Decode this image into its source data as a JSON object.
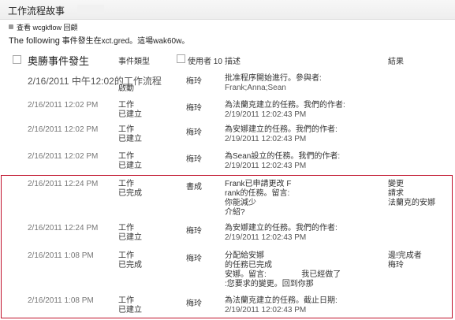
{
  "header": {
    "title": "工作流程故事"
  },
  "view_link": "查看 wcgkflow 回顧",
  "notice": {
    "lead": "The following",
    "rest": "事件發生在xct.gred。這場wak60w。"
  },
  "columns": {
    "date": "奧勝事件發生",
    "event_type": "事件類型",
    "user": "使用者 10",
    "description": "描述",
    "outcome": "結果"
  },
  "rows": [
    {
      "date": "2/16/2011 中午12:02的工作流程",
      "event": [
        "",
        "啟動"
      ],
      "user": "梅玲",
      "desc": [
        "批准程序開始進行。參與者:",
        "Frank;Anna;Sean"
      ],
      "result": []
    },
    {
      "date": "2/16/2011 12:02 PM",
      "event": [
        "工作",
        "已建立"
      ],
      "user": "梅玲",
      "desc": [
        "為法蘭克建立的任務。我們的作者:",
        "2/19/2011 12:02:43 PM"
      ],
      "result": []
    },
    {
      "date": "2/16/2011 12:02 PM",
      "event": [
        "工作",
        "已建立"
      ],
      "user": "梅玲",
      "desc": [
        "為安娜建立的任務。我們的作者:",
        "2/19/2011 12:02:43 PM"
      ],
      "result": []
    },
    {
      "date": "2/16/2011 12:02 PM",
      "event": [
        "工作",
        "已建立"
      ],
      "user": "梅玲",
      "desc": [
        "為Sean設立的任務。我們的作者:",
        "2/19/2011 12:02:43 PM"
      ],
      "result": []
    },
    {
      "date": "2/16/2011 12:24 PM",
      "event": [
        "工作",
        "已完成"
      ],
      "user": "書成",
      "desc": [
        "Frank已申請更改 F",
        "rank的任務。留言:",
        "你能減少",
        "介紹?"
      ],
      "result": [
        "變更",
        "請求",
        "法蘭克的安娜"
      ]
    },
    {
      "date": "2/16/2011 12:24 PM",
      "event": [
        "工作",
        "已建立"
      ],
      "user": "梅玲",
      "desc": [
        "為安娜建立的任務。我們的作者:",
        "2/19/2011 12:02:43 PM"
      ],
      "result": []
    },
    {
      "date": "2/16/2011 1:08 PM",
      "event": [
        "工作",
        "已完成"
      ],
      "user": "梅玲",
      "desc": [
        "分配給安娜",
        "的任務已完成",
        "安娜。留言:                我已經做了",
        ":您要求的變更。回到你那"
      ],
      "result": [
        "邊!完成者",
        "梅玲"
      ]
    },
    {
      "date": "2/16/2011 1:08 PM",
      "event": [
        "工作",
        "已建立"
      ],
      "user": "梅玲",
      "desc": [
        "為法蘭克建立的任務。截止日期:",
        "2/19/2011 12:02:43 PM"
      ],
      "result": []
    }
  ]
}
